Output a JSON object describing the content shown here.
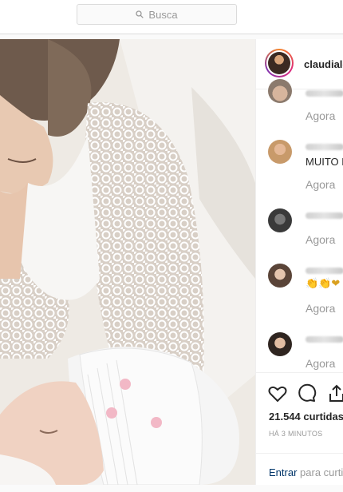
{
  "search": {
    "placeholder": "Busca"
  },
  "post": {
    "username": "claudiale",
    "photo_description": "",
    "comments": [
      {
        "text": "",
        "time": "Agora"
      },
      {
        "text": "MUITO F",
        "time": "Agora"
      },
      {
        "text": "",
        "time": "Agora"
      },
      {
        "text": "👏👏❤",
        "time": "Agora"
      },
      {
        "text": "",
        "time": "Agora"
      }
    ],
    "likes": "21.544 curtidas",
    "posted_ago": "HÁ 3 MINUTOS",
    "login_link": "Entrar",
    "login_suffix": "para curti"
  },
  "icons": {
    "search": "search-icon",
    "like": "heart-icon",
    "comment": "comment-icon",
    "share": "share-icon"
  }
}
